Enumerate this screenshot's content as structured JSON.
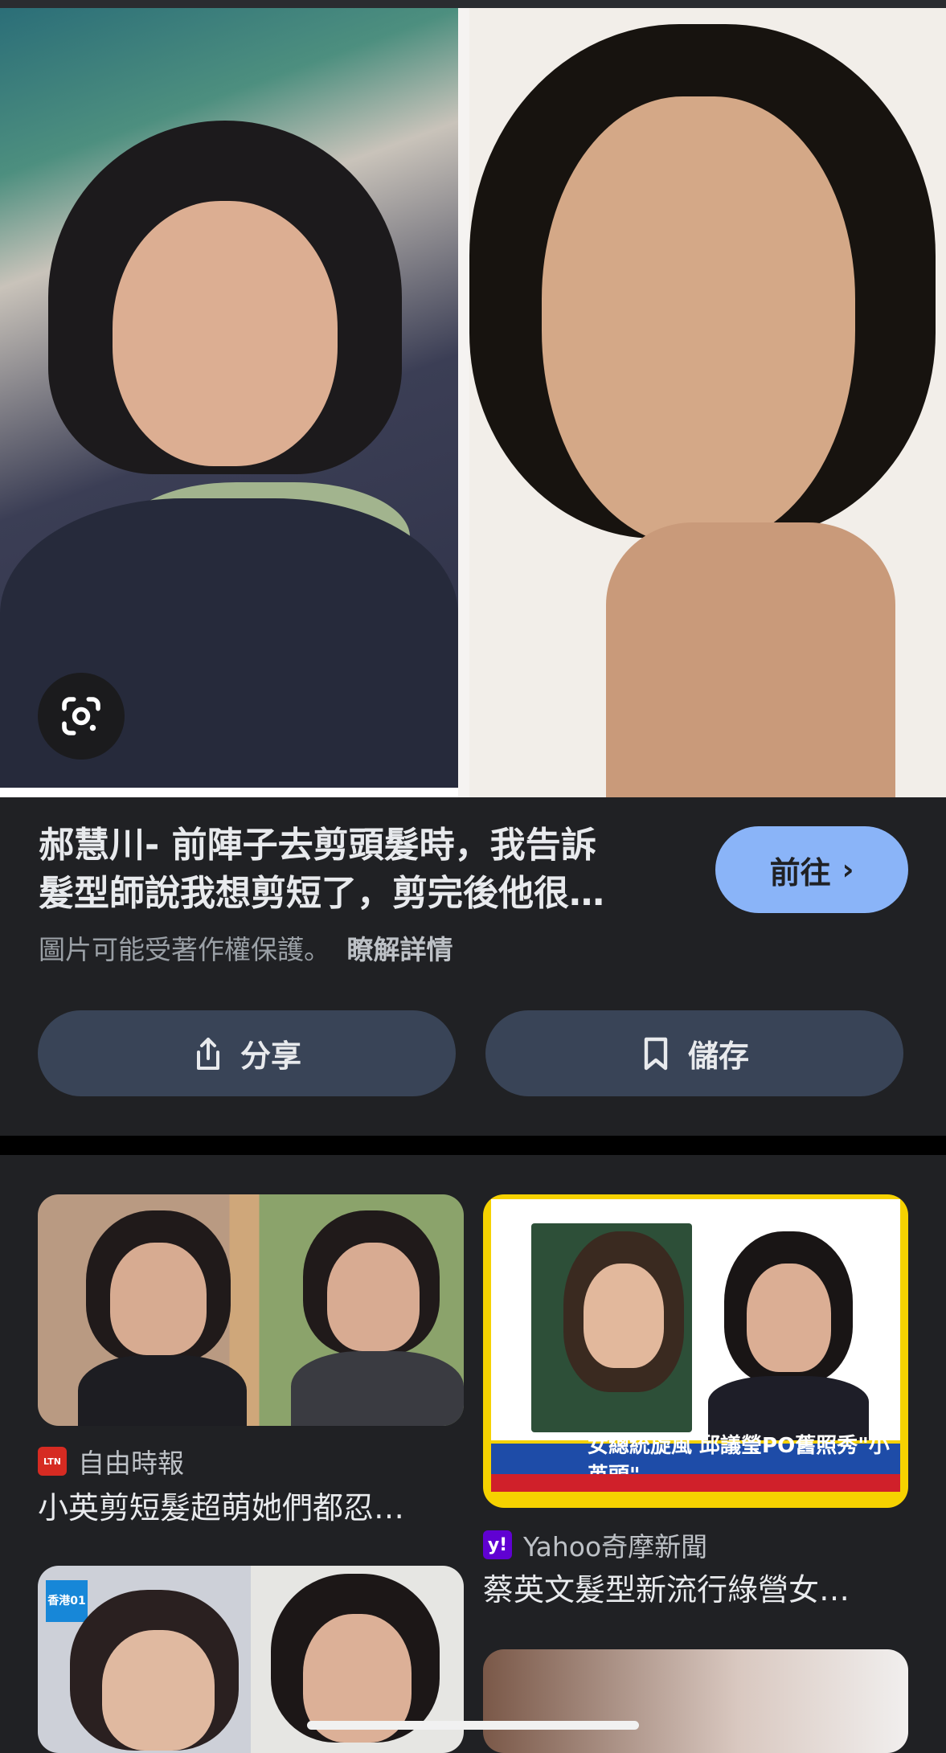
{
  "result": {
    "title": "郝慧川- 前陣子去剪頭髮時，我告訴\n髮型師說我想剪短了，剪完後他很…",
    "copyright_notice": "圖片可能受著作權保護。",
    "learn_more": "瞭解詳情",
    "goto_label": "前往",
    "share_label": "分享",
    "save_label": "儲存"
  },
  "related": [
    {
      "source": "自由時報",
      "favicon_text": "LTN",
      "title": "小英剪短髮超萌她們都忍…"
    },
    {
      "source": "Yahoo奇摩新聞",
      "favicon_text": "y!",
      "title": "蔡英文髮型新流行綠營女…",
      "image_caption": "女總統旋風 邱議瑩PO舊照秀\"小英頭\""
    },
    {
      "badge_text": "香港01"
    }
  ],
  "colors": {
    "background": "#202124",
    "goto_button": "#8ab4f8",
    "action_button": "#394457",
    "text_primary": "#e8eaed",
    "text_secondary": "#9aa0a6"
  },
  "icons": {
    "lens": "google-lens-icon",
    "share": "share-icon",
    "save": "bookmark-icon",
    "goto": "chevron-right-icon"
  }
}
